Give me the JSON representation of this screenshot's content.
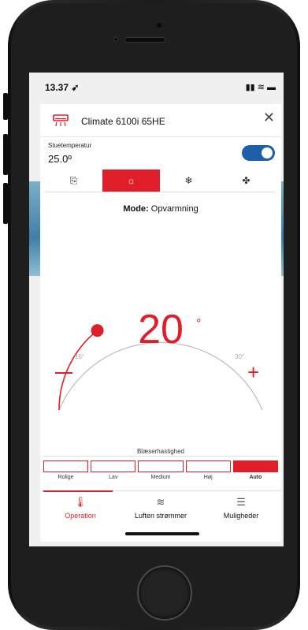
{
  "status_bar": {
    "time": "13.37 ➶",
    "icons": "▮▮ ≋ ▬"
  },
  "header": {
    "icon": "air-conditioner-icon",
    "title": "Climate 6100i 65HE",
    "close": "✕"
  },
  "room": {
    "label": "Stuetemperatur",
    "value": "25.0º",
    "power_on": true
  },
  "modes": [
    {
      "name": "auto-mode-icon",
      "glyph": "⎘",
      "active": false
    },
    {
      "name": "sun-icon",
      "glyph": "☼",
      "active": true
    },
    {
      "name": "snowflake-icon",
      "glyph": "❄",
      "active": false
    },
    {
      "name": "fan-icon",
      "glyph": "✤",
      "active": false
    }
  ],
  "mode_line": {
    "prefix": "Mode:",
    "value": "Opvarmning"
  },
  "thermostat": {
    "setpoint": "20",
    "degree": "°",
    "min_label": "16°",
    "max_label": "30°",
    "min": 16,
    "max": 30,
    "value": 20,
    "minus": "−",
    "plus": "+"
  },
  "fan_speed": {
    "title": "Blæserhastighed",
    "levels": [
      "Rolige",
      "Lav",
      "Medium",
      "Høj",
      "Auto"
    ],
    "active_index": 4
  },
  "tabs": [
    {
      "label": "Operation",
      "icon": "thermometer-icon",
      "glyph": "🌡",
      "active": true
    },
    {
      "label": "Luften strømmer",
      "icon": "airflow-icon",
      "glyph": "≋",
      "active": false
    },
    {
      "label": "Muligheder",
      "icon": "list-icon",
      "glyph": "☰",
      "active": false
    }
  ],
  "colors": {
    "accent": "#e01e2a",
    "toggle": "#1e5fa8"
  }
}
